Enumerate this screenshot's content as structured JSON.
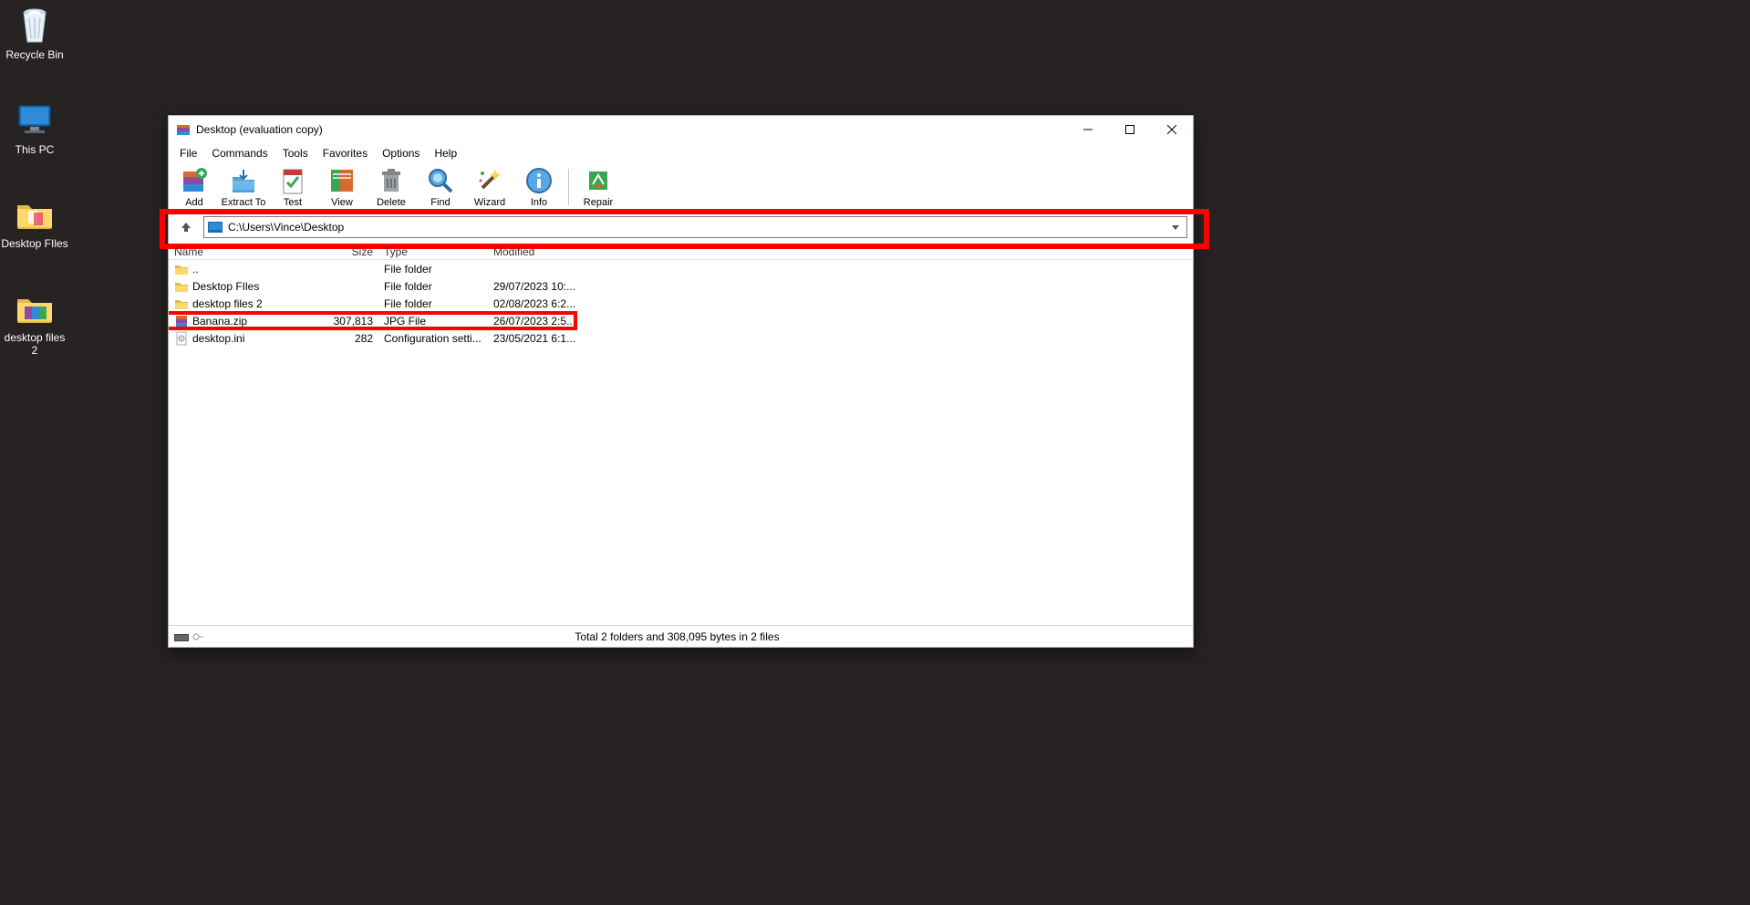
{
  "desktop_icons": {
    "recycle_bin": "Recycle Bin",
    "this_pc": "This PC",
    "desktop_files": "Desktop FIles",
    "desktop_files_2": "desktop files 2"
  },
  "window": {
    "title": "Desktop (evaluation copy)",
    "menu": {
      "file": "File",
      "commands": "Commands",
      "tools": "Tools",
      "favorites": "Favorites",
      "options": "Options",
      "help": "Help"
    },
    "toolbar": {
      "add": "Add",
      "extract": "Extract To",
      "test": "Test",
      "view": "View",
      "delete": "Delete",
      "find": "Find",
      "wizard": "Wizard",
      "info": "Info",
      "repair": "Repair"
    },
    "path": "C:\\Users\\Vince\\Desktop",
    "columns": {
      "name": "Name",
      "size": "Size",
      "type": "Type",
      "modified": "Modified"
    },
    "rows": [
      {
        "icon": "folder",
        "name": "..",
        "size": "",
        "type": "File folder",
        "modified": ""
      },
      {
        "icon": "folder",
        "name": "Desktop FIles",
        "size": "",
        "type": "File folder",
        "modified": "29/07/2023 10:..."
      },
      {
        "icon": "folder",
        "name": "desktop files 2",
        "size": "",
        "type": "File folder",
        "modified": "02/08/2023 6:2..."
      },
      {
        "icon": "zip",
        "name": "Banana.zip",
        "size": "307,813",
        "type": "JPG File",
        "modified": "26/07/2023 2:5..."
      },
      {
        "icon": "ini",
        "name": "desktop.ini",
        "size": "282",
        "type": "Configuration setti...",
        "modified": "23/05/2021 6:1..."
      }
    ],
    "status": "Total 2 folders and 308,095 bytes in 2 files"
  }
}
